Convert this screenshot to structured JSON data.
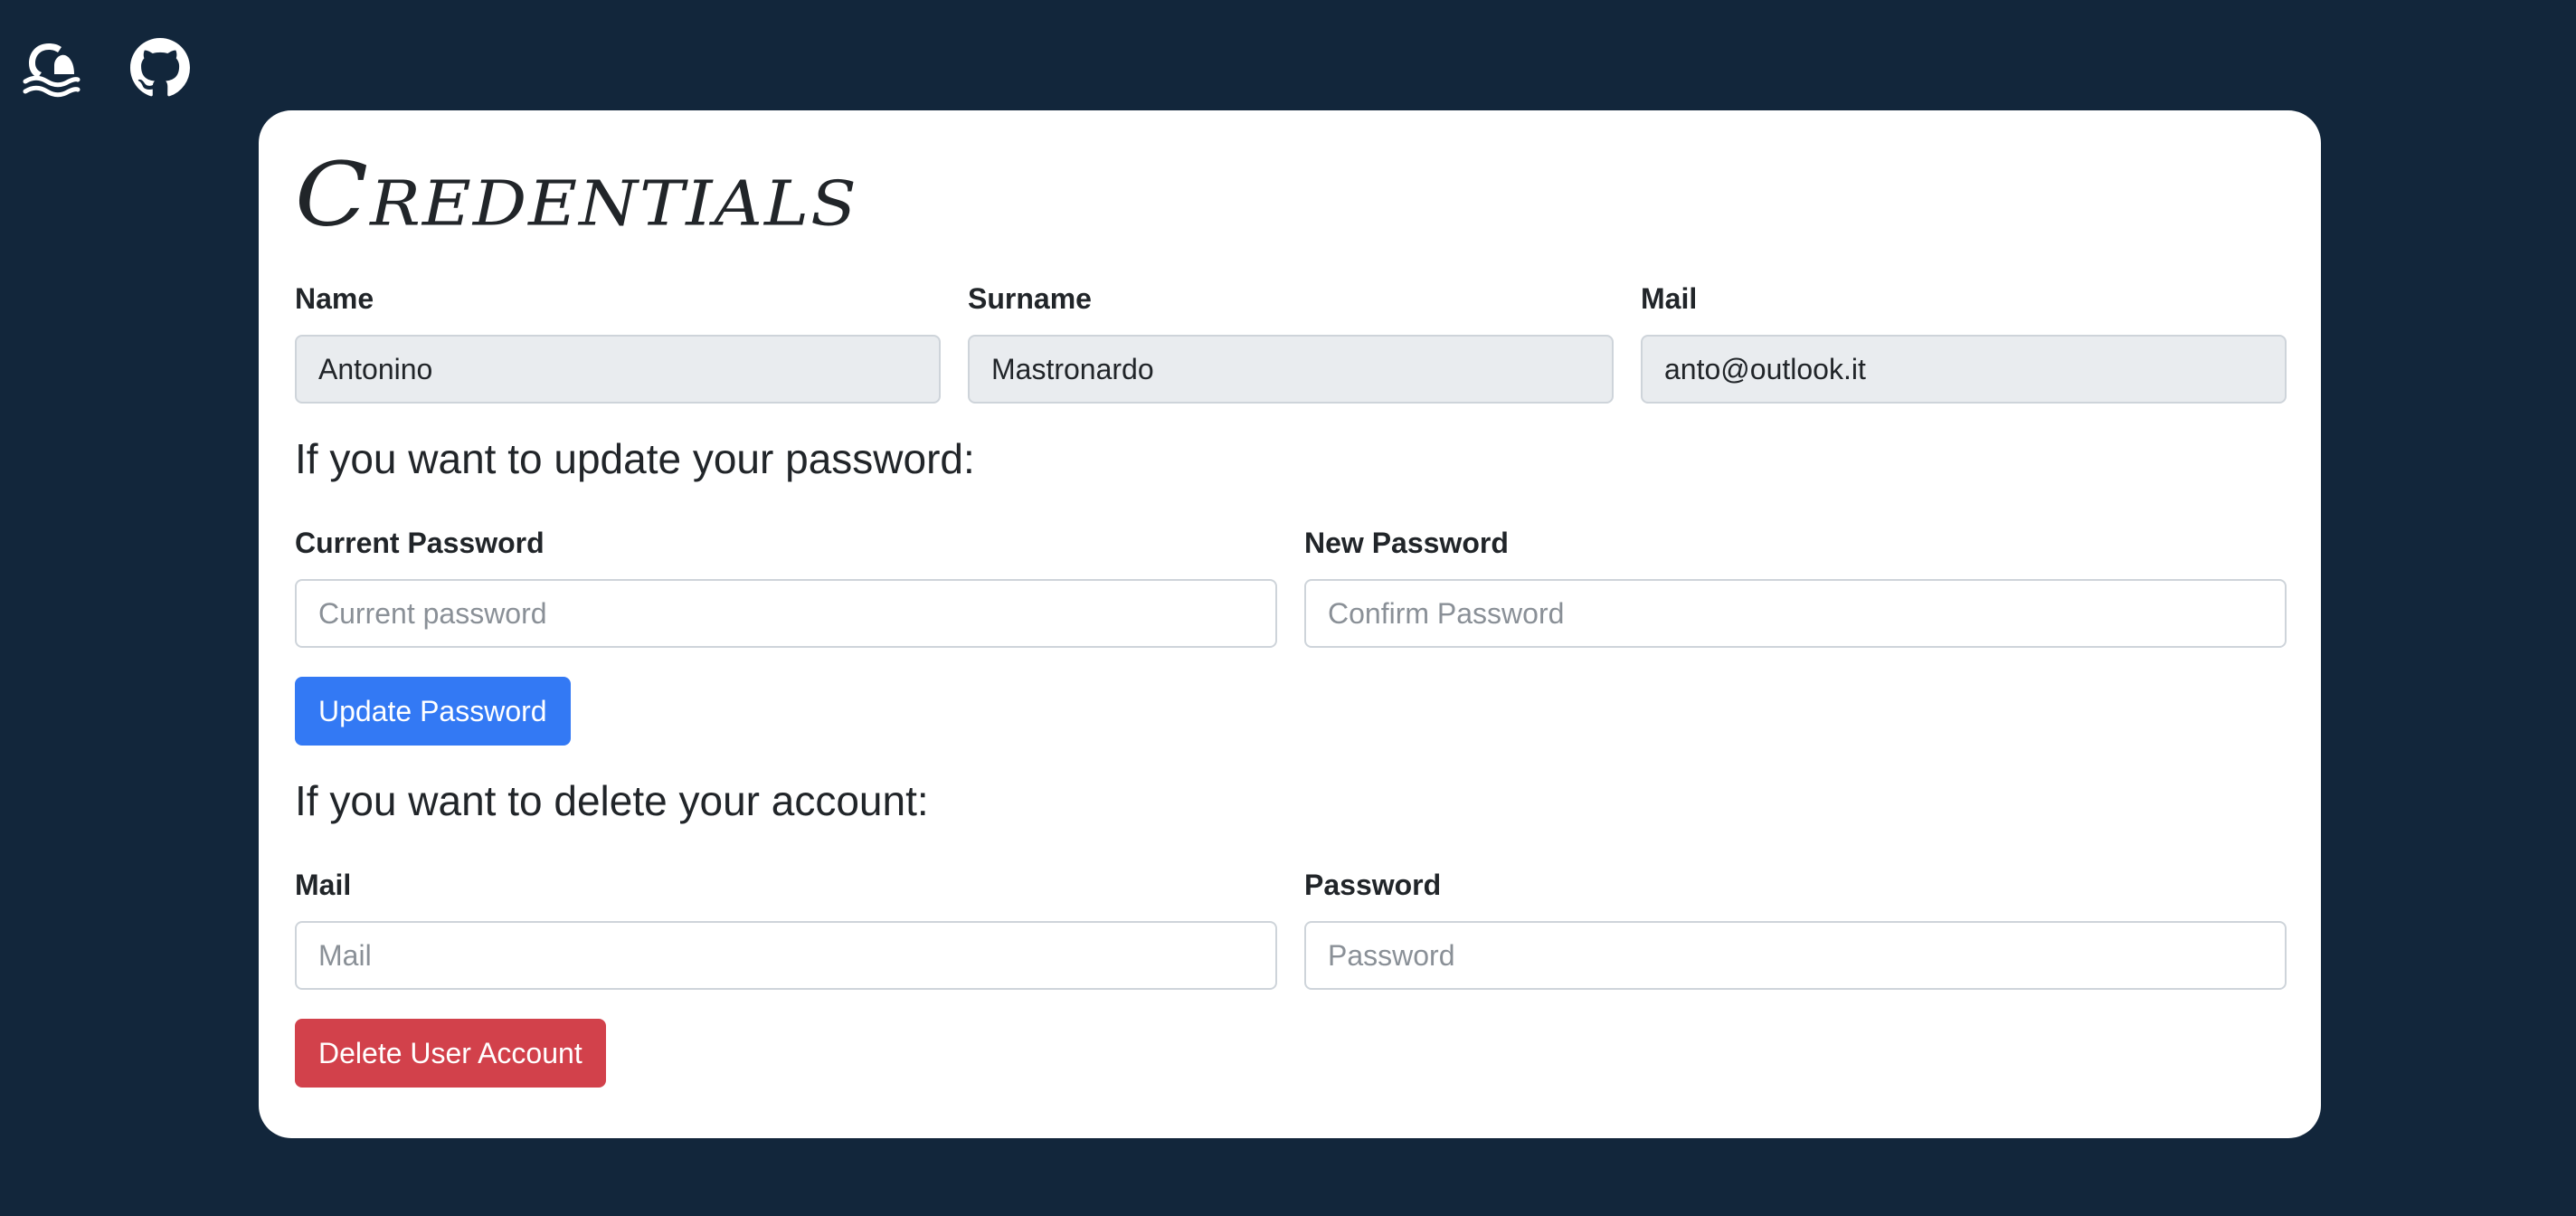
{
  "header": {
    "logo_icon": "wave-logo-icon",
    "github_icon": "github-icon"
  },
  "card": {
    "title": "Credentials",
    "profile": {
      "name_label": "Name",
      "name_value": "Antonino",
      "surname_label": "Surname",
      "surname_value": "Mastronardo",
      "mail_label": "Mail",
      "mail_value": "anto@outlook.it"
    },
    "update_password": {
      "heading": "If you want to update your password:",
      "current_label": "Current Password",
      "current_placeholder": "Current password",
      "new_label": "New Password",
      "new_placeholder": "Confirm Password",
      "button_label": "Update Password"
    },
    "delete_account": {
      "heading": "If you want to delete your account:",
      "mail_label": "Mail",
      "mail_placeholder": "Mail",
      "password_label": "Password",
      "password_placeholder": "Password",
      "button_label": "Delete User Account"
    }
  },
  "colors": {
    "background": "#12263b",
    "card": "#ffffff",
    "primary": "#3379f4",
    "danger": "#d2414b",
    "readonly_field": "#e9ecef"
  }
}
